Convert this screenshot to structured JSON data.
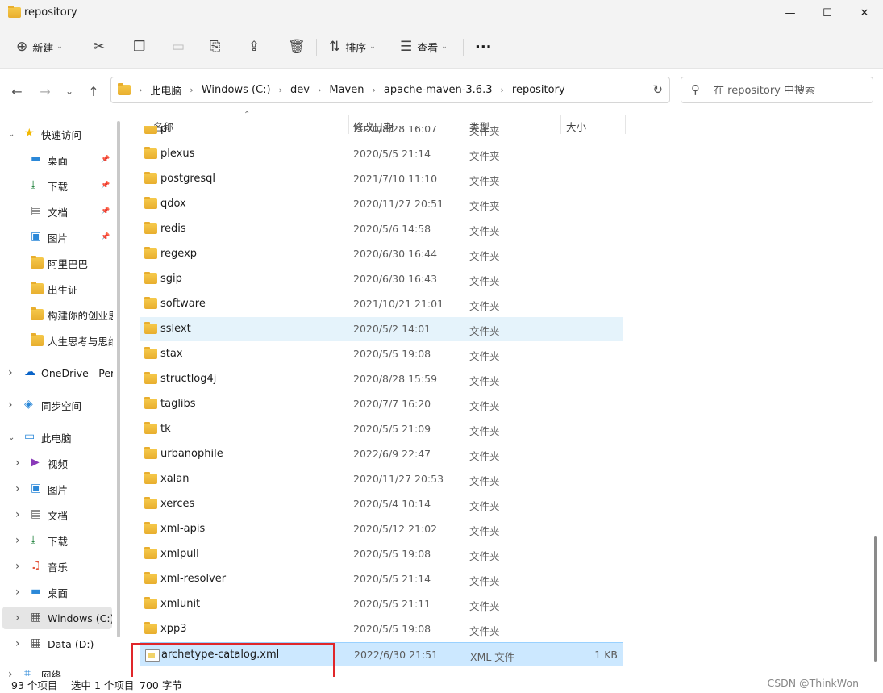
{
  "window": {
    "title": "repository",
    "minimize": "—",
    "maximize": "☐",
    "close": "✕"
  },
  "toolbar": {
    "new_label": "新建",
    "sort_label": "排序",
    "view_label": "查看",
    "more_label": "···"
  },
  "nav": {
    "back": "←",
    "forward": "→",
    "recent": "⌄",
    "up": "↑",
    "refresh": "↻"
  },
  "breadcrumbs": [
    "此电脑",
    "Windows (C:)",
    "dev",
    "Maven",
    "apache-maven-3.6.3",
    "repository"
  ],
  "search": {
    "placeholder": "在 repository 中搜索"
  },
  "sidebar": {
    "items": [
      {
        "label": "快速访问",
        "icon": "star-icon",
        "level": 0,
        "expand": "down"
      },
      {
        "label": "桌面",
        "icon": "desktop-icon",
        "level": 1,
        "pinned": true
      },
      {
        "label": "下载",
        "icon": "download-icon",
        "level": 1,
        "pinned": true
      },
      {
        "label": "文档",
        "icon": "document-icon",
        "level": 1,
        "pinned": true
      },
      {
        "label": "图片",
        "icon": "pictures-icon",
        "level": 1,
        "pinned": true
      },
      {
        "label": "阿里巴巴",
        "icon": "folder-icon",
        "level": 1
      },
      {
        "label": "出生证",
        "icon": "folder-icon",
        "level": 1
      },
      {
        "label": "构建你的创业思",
        "icon": "folder-icon",
        "level": 1
      },
      {
        "label": "人生思考与思维",
        "icon": "folder-icon",
        "level": 1
      },
      {
        "label": "OneDrive - Pers",
        "icon": "cloud-icon",
        "level": 0,
        "expand": "right"
      },
      {
        "label": "同步空间",
        "icon": "sync-icon",
        "level": 0,
        "expand": "right"
      },
      {
        "label": "此电脑",
        "icon": "computer-icon",
        "level": 0,
        "expand": "down"
      },
      {
        "label": "视频",
        "icon": "video-icon",
        "level": 1,
        "expand": "right"
      },
      {
        "label": "图片",
        "icon": "pictures-icon",
        "level": 1,
        "expand": "right"
      },
      {
        "label": "文档",
        "icon": "document-icon",
        "level": 1,
        "expand": "right"
      },
      {
        "label": "下载",
        "icon": "download-icon",
        "level": 1,
        "expand": "right"
      },
      {
        "label": "音乐",
        "icon": "music-icon",
        "level": 1,
        "expand": "right"
      },
      {
        "label": "桌面",
        "icon": "desktop-icon",
        "level": 1,
        "expand": "right"
      },
      {
        "label": "Windows (C:)",
        "icon": "drive-icon",
        "level": 1,
        "expand": "right",
        "selected": true
      },
      {
        "label": "Data (D:)",
        "icon": "drive-icon",
        "level": 1,
        "expand": "right"
      },
      {
        "label": "网络",
        "icon": "network-icon",
        "level": 0,
        "expand": "right"
      }
    ]
  },
  "columns": {
    "name": "名称",
    "modified": "修改日期",
    "type": "类型",
    "size": "大小"
  },
  "files": [
    {
      "name": "pl",
      "date": "2020/8/28 16:07",
      "type": "文件夹",
      "size": ""
    },
    {
      "name": "plexus",
      "date": "2020/5/5 21:14",
      "type": "文件夹",
      "size": ""
    },
    {
      "name": "postgresql",
      "date": "2021/7/10 11:10",
      "type": "文件夹",
      "size": ""
    },
    {
      "name": "qdox",
      "date": "2020/11/27 20:51",
      "type": "文件夹",
      "size": ""
    },
    {
      "name": "redis",
      "date": "2020/5/6 14:58",
      "type": "文件夹",
      "size": ""
    },
    {
      "name": "regexp",
      "date": "2020/6/30 16:44",
      "type": "文件夹",
      "size": ""
    },
    {
      "name": "sgip",
      "date": "2020/6/30 16:43",
      "type": "文件夹",
      "size": ""
    },
    {
      "name": "software",
      "date": "2021/10/21 21:01",
      "type": "文件夹",
      "size": ""
    },
    {
      "name": "sslext",
      "date": "2020/5/2 14:01",
      "type": "文件夹",
      "size": "",
      "hover": true
    },
    {
      "name": "stax",
      "date": "2020/5/5 19:08",
      "type": "文件夹",
      "size": ""
    },
    {
      "name": "structlog4j",
      "date": "2020/8/28 15:59",
      "type": "文件夹",
      "size": ""
    },
    {
      "name": "taglibs",
      "date": "2020/7/7 16:20",
      "type": "文件夹",
      "size": ""
    },
    {
      "name": "tk",
      "date": "2020/5/5 21:09",
      "type": "文件夹",
      "size": ""
    },
    {
      "name": "urbanophile",
      "date": "2022/6/9 22:47",
      "type": "文件夹",
      "size": ""
    },
    {
      "name": "xalan",
      "date": "2020/11/27 20:53",
      "type": "文件夹",
      "size": ""
    },
    {
      "name": "xerces",
      "date": "2020/5/4 10:14",
      "type": "文件夹",
      "size": ""
    },
    {
      "name": "xml-apis",
      "date": "2020/5/12 21:02",
      "type": "文件夹",
      "size": ""
    },
    {
      "name": "xmlpull",
      "date": "2020/5/5 19:08",
      "type": "文件夹",
      "size": ""
    },
    {
      "name": "xml-resolver",
      "date": "2020/5/5 21:14",
      "type": "文件夹",
      "size": ""
    },
    {
      "name": "xmlunit",
      "date": "2020/5/5 21:11",
      "type": "文件夹",
      "size": ""
    },
    {
      "name": "xpp3",
      "date": "2020/5/5 19:08",
      "type": "文件夹",
      "size": ""
    },
    {
      "name": "archetype-catalog.xml",
      "date": "2022/6/30 21:51",
      "type": "XML 文件",
      "size": "1 KB",
      "selected": true,
      "xml": true
    }
  ],
  "status": {
    "count": "93 个项目",
    "selection": "选中 1 个项目",
    "size": "700 字节"
  },
  "watermark": "CSDN @ThinkWon",
  "colors": {
    "accent": "#0067c0",
    "highlight": "#e0262a",
    "selected_row": "#cce8ff"
  }
}
